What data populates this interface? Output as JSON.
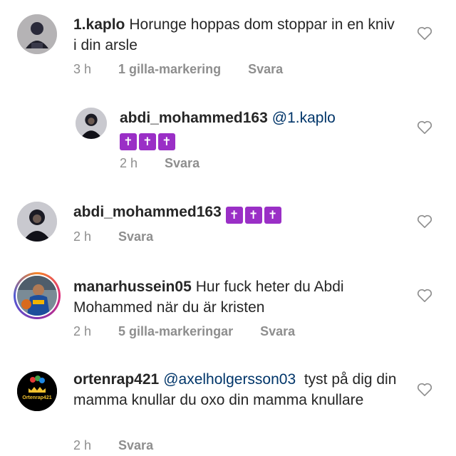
{
  "comments": [
    {
      "username": "1.kaplo",
      "text": "Horunge hoppas dom stoppar in en kniv i din arsle",
      "time": "3 h",
      "likes": "1 gilla-markering",
      "reply": "Svara",
      "avatar_icon": "avatar-person-dark-icon",
      "reply_level": 0
    },
    {
      "username": "abdi_mohammed163",
      "mention": "@1.kaplo",
      "emoji": [
        "✝",
        "✝",
        "✝"
      ],
      "time": "2 h",
      "reply": "Svara",
      "avatar_icon": "avatar-person-hood-icon",
      "reply_level": 1
    },
    {
      "username": "abdi_mohammed163",
      "emoji": [
        "✝",
        "✝",
        "✝"
      ],
      "time": "2 h",
      "reply": "Svara",
      "avatar_icon": "avatar-person-hood-icon",
      "reply_level": 0
    },
    {
      "username": "manarhussein05",
      "text": "Hur fuck heter du Abdi Mohammed när du är kristen",
      "time": "2 h",
      "likes": "5 gilla-markeringar",
      "reply": "Svara",
      "avatar_icon": "avatar-basketball-player-icon",
      "has_story_ring": true,
      "reply_level": 0
    },
    {
      "username": "ortenrap421",
      "mention": "@axelholgersson03",
      "text": "tyst på dig din mamma knullar du oxo din mamma knullare",
      "time": "2 h",
      "reply": "Svara",
      "avatar_icon": "avatar-ortenrap-logo-icon",
      "avatar_logo_text": "Ortenrap421",
      "reply_level": 0
    }
  ],
  "colors": {
    "text": "#262626",
    "muted": "#8e8e8e",
    "mention": "#003569",
    "emoji_bg": "#9a2fc6"
  }
}
